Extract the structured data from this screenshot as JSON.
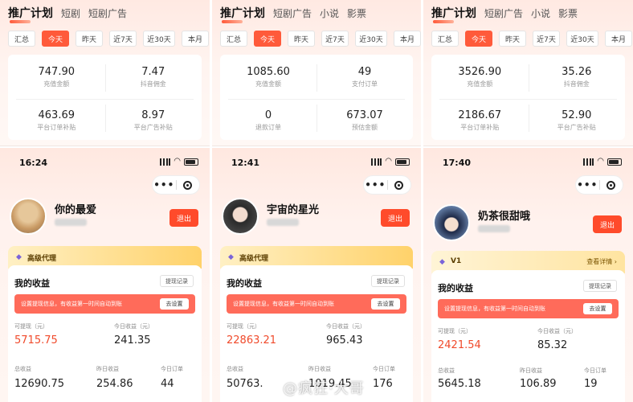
{
  "colors": {
    "accent": "#ff5a3a",
    "logout": "#ff4b2b",
    "notice_bg": "#ff6b5a",
    "agent_gold": "#ffd26a",
    "amount_red": "#f04a2b"
  },
  "watermark": "@疯狂·大哥",
  "columns": [
    {
      "tabs": [
        "推广计划",
        "短剧",
        "短剧广告"
      ],
      "filters": [
        "汇总",
        "今天",
        "昨天",
        "近7天",
        "近30天",
        "本月"
      ],
      "active_filter": "今天",
      "stats": [
        {
          "value": "747.90",
          "label": "充值金额"
        },
        {
          "value": "7.47",
          "label": "抖音佣金"
        },
        {
          "value": "463.69",
          "label": "平台订单补贴"
        },
        {
          "value": "8.97",
          "label": "平台广告补贴"
        }
      ],
      "phone": {
        "time": "16:24",
        "icons": {
          "signal": "signal-icon",
          "wifi": "wifi-icon",
          "battery": "battery-icon",
          "more": "more-dots-icon",
          "close": "target-close-icon"
        },
        "avatar": "cat-photo",
        "name": "你的最爱",
        "logout": "退出",
        "agent_label": "高级代理",
        "agent_detail": "",
        "earnings_title": "我的收益",
        "withdraw_record": "提现记录",
        "notice": "设置提现信息，有收益第一时间自动到账",
        "notice_btn": "去设置",
        "withdrawable_label": "可提现（元）",
        "withdrawable": "5715.75",
        "today_label": "今日收益（元）",
        "today": "241.35",
        "total_label": "总收益",
        "total": "12690.75",
        "yesterday_label": "昨日收益",
        "yesterday": "254.86",
        "orders_label": "今日订单",
        "orders": "44"
      }
    },
    {
      "tabs": [
        "推广计划",
        "短剧广告",
        "小说",
        "影票"
      ],
      "filters": [
        "汇总",
        "今天",
        "昨天",
        "近7天",
        "近30天",
        "本月"
      ],
      "active_filter": "今天",
      "stats": [
        {
          "value": "1085.60",
          "label": "充值金额"
        },
        {
          "value": "49",
          "label": "支付订单"
        },
        {
          "value": "0",
          "label": "退款订单"
        },
        {
          "value": "673.07",
          "label": "预估金额"
        }
      ],
      "phone": {
        "time": "12:41",
        "icons": {
          "signal": "signal-icon",
          "wifi": "wifi-icon",
          "battery": "battery-icon",
          "more": "more-dots-icon",
          "close": "target-close-icon"
        },
        "avatar": "girl-photo",
        "name": "宇宙的星光",
        "logout": "退出",
        "agent_label": "高级代理",
        "agent_detail": "",
        "earnings_title": "我的收益",
        "withdraw_record": "提现记录",
        "notice": "设置提现信息，有收益第一时间自动到账",
        "notice_btn": "去设置",
        "withdrawable_label": "可提现（元）",
        "withdrawable": "22863.21",
        "today_label": "今日收益（元）",
        "today": "965.43",
        "total_label": "总收益",
        "total": "50763.",
        "yesterday_label": "昨日收益",
        "yesterday": "1019.45",
        "orders_label": "今日订单",
        "orders": "176"
      }
    },
    {
      "tabs": [
        "推广计划",
        "短剧广告",
        "小说",
        "影票"
      ],
      "filters": [
        "汇总",
        "今天",
        "昨天",
        "近7天",
        "近30天",
        "本月"
      ],
      "active_filter": "今天",
      "stats": [
        {
          "value": "3526.90",
          "label": "充值金额"
        },
        {
          "value": "35.26",
          "label": "抖音佣金"
        },
        {
          "value": "2186.67",
          "label": "平台订单补贴"
        },
        {
          "value": "52.90",
          "label": "平台广告补贴"
        }
      ],
      "phone": {
        "time": "17:40",
        "icons": {
          "signal": "signal-icon",
          "wifi": "wifi-icon",
          "battery": "battery-icon",
          "more": "more-dots-icon",
          "close": "target-close-icon"
        },
        "avatar": "anime-boy-photo",
        "name": "奶茶很甜哦",
        "logout": "退出",
        "agent_label": "V1",
        "agent_detail": "查看详情 ›",
        "earnings_title": "我的收益",
        "withdraw_record": "提现记录",
        "notice": "设置提现信息，有收益第一时间自动到账",
        "notice_btn": "去设置",
        "withdrawable_label": "可提现（元）",
        "withdrawable": "2421.54",
        "today_label": "今日收益（元）",
        "today": "85.32",
        "total_label": "总收益",
        "total": "5645.18",
        "yesterday_label": "昨日收益",
        "yesterday": "106.89",
        "orders_label": "今日订单",
        "orders": "19"
      }
    }
  ]
}
